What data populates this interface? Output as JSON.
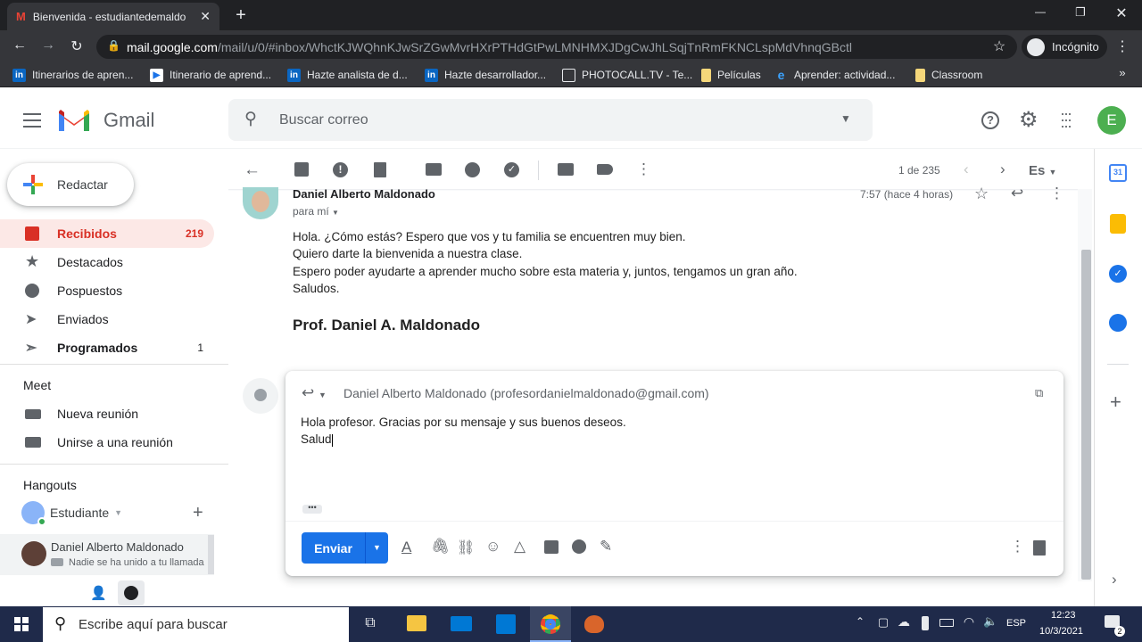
{
  "browser": {
    "tab_title": "Bienvenida - estudiantedemaldo",
    "url_domain": "mail.google.com",
    "url_path": "/mail/u/0/#inbox/WhctKJWQhnKJwSrZGwMvrHXrPTHdGtPwLMNHMXJDgCwJhLSqjTnRmFKNCLspMdVhnqGBctl",
    "profile_label": "Incógnito",
    "bookmarks": [
      {
        "label": "Itinerarios de apren...",
        "icon": "linkedin-icon"
      },
      {
        "label": "Itinerario de aprend...",
        "icon": "video-icon"
      },
      {
        "label": "Hazte analista de d...",
        "icon": "linkedin-icon"
      },
      {
        "label": "Hazte desarrollador...",
        "icon": "linkedin-icon"
      },
      {
        "label": "PHOTOCALL.TV - Te...",
        "icon": "tv-icon"
      },
      {
        "label": "Películas",
        "icon": "folder-icon"
      },
      {
        "label": "Aprender: actividad...",
        "icon": "edge-icon"
      },
      {
        "label": "Classroom",
        "icon": "folder-icon"
      }
    ]
  },
  "gmail": {
    "logo_text": "Gmail",
    "search_placeholder": "Buscar correo",
    "avatar_letter": "E",
    "compose_label": "Redactar",
    "nav": [
      {
        "label": "Recibidos",
        "count": "219",
        "icon": "inbox-icon",
        "active": true
      },
      {
        "label": "Destacados",
        "count": "",
        "icon": "star-icon"
      },
      {
        "label": "Pospuestos",
        "count": "",
        "icon": "clock-icon"
      },
      {
        "label": "Enviados",
        "count": "",
        "icon": "send-icon"
      },
      {
        "label": "Programados",
        "count": "1",
        "icon": "scheduled-icon",
        "bold": true
      }
    ],
    "meet": {
      "title": "Meet",
      "new_meeting": "Nueva reunión",
      "join_meeting": "Unirse a una reunión"
    },
    "hangouts": {
      "title": "Hangouts",
      "user": "Estudiante",
      "contact_name": "Daniel Alberto Maldonado",
      "contact_status": "Nadie se ha unido a tu llamada"
    },
    "toolbar": {
      "pagination": "1 de 235",
      "lang": "Es"
    },
    "message": {
      "sender": "Daniel Alberto Maldonado",
      "to": "para mí",
      "time": "7:57 (hace 4 horas)",
      "lines": [
        "Hola. ¿Cómo estás? Espero que vos y tu familia se encuentren muy bien.",
        "Quiero darte la bienvenida a nuestra clase.",
        "Espero poder ayudarte a aprender mucho sobre esta materia y, juntos, tengamos un gran año.",
        "Saludos."
      ],
      "signature": "Prof. Daniel A. Maldonado"
    },
    "reply": {
      "recipient": "Daniel Alberto Maldonado (profesordanielmaldonado@gmail.com)",
      "line1": "Hola profesor. Gracias por su mensaje y sus buenos deseos.",
      "line2": "Salud",
      "send_label": "Enviar"
    }
  },
  "taskbar": {
    "search_placeholder": "Escribe aquí para buscar",
    "lang": "ESP",
    "time": "12:23",
    "date": "10/3/2021",
    "notifications": "2"
  }
}
